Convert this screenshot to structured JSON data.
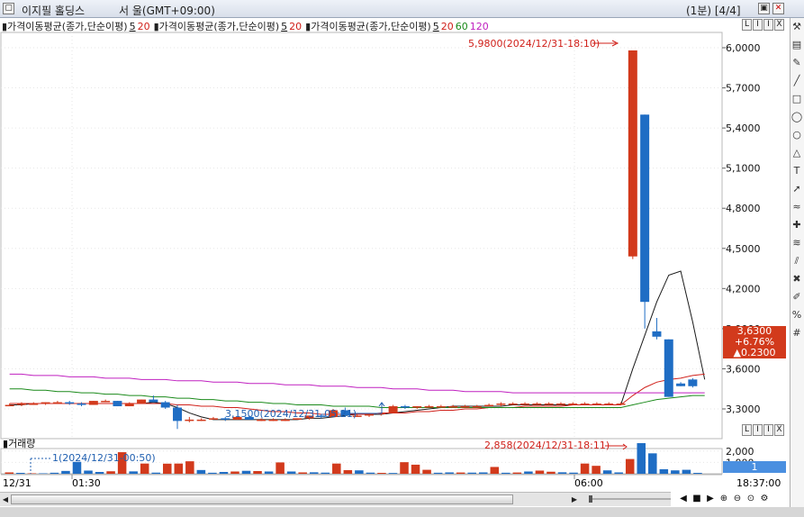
{
  "window": {
    "stock_name": "이지필 홀딩스",
    "market": "서  울(GMT+09:00)",
    "period": "(1분) [4/4]"
  },
  "legend": {
    "items": [
      {
        "label": "가격이동평균(종가,단순이평)",
        "periods": [
          {
            "text": "5",
            "color": "#1a1a1a"
          },
          {
            "text": "20",
            "color": "#d0201a"
          }
        ]
      },
      {
        "label": "가격이동평균(종가,단순이평)",
        "periods": [
          {
            "text": "5",
            "color": "#1a1a1a"
          },
          {
            "text": "20",
            "color": "#d0201a"
          }
        ]
      },
      {
        "label": "가격이동평균(종가,단순이평)",
        "periods": [
          {
            "text": "5",
            "color": "#1a1a1a"
          },
          {
            "text": "20",
            "color": "#d0201a"
          },
          {
            "text": "60",
            "color": "#1a8a1a"
          },
          {
            "text": "120",
            "color": "#c020c0"
          }
        ]
      }
    ]
  },
  "panel_buttons": [
    "L",
    "I",
    "I",
    "X"
  ],
  "current_price": {
    "price": "3,6300",
    "change_pct": "+6.76%",
    "change": "▲0.2300"
  },
  "volume_panel": {
    "title": "거래량",
    "current": "1",
    "min_annotation": "1(2024/12/31-00:50)",
    "max_annotation": "2,858(2024/12/31-18:11)"
  },
  "price_annotations": {
    "high": "5,9800(2024/12/31-18:10)",
    "low": "3,1500(2024/12/31-05:21)"
  },
  "time_labels": {
    "left": "12/31",
    "t1": "01:30",
    "t2": "06:00",
    "right": "18:37:00"
  },
  "toolbar_icons": [
    "tool-icon",
    "chart-icon",
    "draw-icon",
    "line-icon",
    "rect-icon",
    "ellipse-icon",
    "circle-icon",
    "triangle-icon",
    "text-icon",
    "arrow-icon",
    "wave-icon",
    "cross-icon",
    "fib-icon",
    "channel-icon",
    "delete-icon",
    "edit-icon",
    "percent-icon",
    "counter-icon"
  ],
  "colors": {
    "up": "#d23a1c",
    "down": "#1f6dc4",
    "ma5": "#1a1a1a",
    "ma20": "#d0201a",
    "ma60": "#1a8a1a",
    "ma120": "#c020c0"
  },
  "chart_data": [
    {
      "type": "candlestick",
      "title": "",
      "ylim": [
        3.2,
        6.1
      ],
      "yticks": [
        "6,0000",
        "5,7000",
        "5,4000",
        "5,1000",
        "4,8000",
        "4,5000",
        "4,2000",
        "3,9000",
        "3,6000",
        "3,3000"
      ],
      "ytick_values": [
        6.0,
        5.7,
        5.4,
        5.1,
        4.8,
        4.5,
        4.2,
        3.9,
        3.6,
        3.3
      ],
      "candles": [
        {
          "o": 3.33,
          "h": 3.34,
          "l": 3.32,
          "c": 3.33
        },
        {
          "o": 3.33,
          "h": 3.35,
          "l": 3.32,
          "c": 3.34
        },
        {
          "o": 3.34,
          "h": 3.35,
          "l": 3.33,
          "c": 3.34
        },
        {
          "o": 3.34,
          "h": 3.35,
          "l": 3.33,
          "c": 3.35
        },
        {
          "o": 3.35,
          "h": 3.36,
          "l": 3.34,
          "c": 3.35
        },
        {
          "o": 3.35,
          "h": 3.36,
          "l": 3.33,
          "c": 3.34
        },
        {
          "o": 3.34,
          "h": 3.35,
          "l": 3.32,
          "c": 3.33
        },
        {
          "o": 3.33,
          "h": 3.36,
          "l": 3.33,
          "c": 3.36
        },
        {
          "o": 3.36,
          "h": 3.37,
          "l": 3.35,
          "c": 3.36
        },
        {
          "o": 3.36,
          "h": 3.36,
          "l": 3.32,
          "c": 3.32
        },
        {
          "o": 3.32,
          "h": 3.35,
          "l": 3.32,
          "c": 3.34
        },
        {
          "o": 3.34,
          "h": 3.37,
          "l": 3.34,
          "c": 3.37
        },
        {
          "o": 3.37,
          "h": 3.4,
          "l": 3.35,
          "c": 3.35
        },
        {
          "o": 3.35,
          "h": 3.36,
          "l": 3.3,
          "c": 3.31
        },
        {
          "o": 3.31,
          "h": 3.33,
          "l": 3.15,
          "c": 3.21
        },
        {
          "o": 3.21,
          "h": 3.24,
          "l": 3.2,
          "c": 3.22
        },
        {
          "o": 3.22,
          "h": 3.23,
          "l": 3.21,
          "c": 3.22
        },
        {
          "o": 3.22,
          "h": 3.24,
          "l": 3.22,
          "c": 3.23
        },
        {
          "o": 3.23,
          "h": 3.24,
          "l": 3.21,
          "c": 3.22
        },
        {
          "o": 3.22,
          "h": 3.24,
          "l": 3.22,
          "c": 3.24
        },
        {
          "o": 3.24,
          "h": 3.25,
          "l": 3.22,
          "c": 3.22
        },
        {
          "o": 3.22,
          "h": 3.23,
          "l": 3.21,
          "c": 3.22
        },
        {
          "o": 3.22,
          "h": 3.23,
          "l": 3.21,
          "c": 3.22
        },
        {
          "o": 3.22,
          "h": 3.23,
          "l": 3.21,
          "c": 3.22
        },
        {
          "o": 3.22,
          "h": 3.23,
          "l": 3.22,
          "c": 3.23
        },
        {
          "o": 3.23,
          "h": 3.25,
          "l": 3.22,
          "c": 3.25
        },
        {
          "o": 3.25,
          "h": 3.26,
          "l": 3.23,
          "c": 3.24
        },
        {
          "o": 3.24,
          "h": 3.3,
          "l": 3.24,
          "c": 3.29
        },
        {
          "o": 3.29,
          "h": 3.31,
          "l": 3.24,
          "c": 3.25
        },
        {
          "o": 3.25,
          "h": 3.27,
          "l": 3.24,
          "c": 3.25
        },
        {
          "o": 3.25,
          "h": 3.26,
          "l": 3.24,
          "c": 3.26
        },
        {
          "o": 3.26,
          "h": 3.27,
          "l": 3.25,
          "c": 3.27
        },
        {
          "o": 3.27,
          "h": 3.33,
          "l": 3.27,
          "c": 3.32
        },
        {
          "o": 3.32,
          "h": 3.33,
          "l": 3.3,
          "c": 3.31
        },
        {
          "o": 3.31,
          "h": 3.32,
          "l": 3.3,
          "c": 3.32
        },
        {
          "o": 3.32,
          "h": 3.33,
          "l": 3.31,
          "c": 3.32
        },
        {
          "o": 3.32,
          "h": 3.33,
          "l": 3.31,
          "c": 3.32
        },
        {
          "o": 3.32,
          "h": 3.33,
          "l": 3.31,
          "c": 3.32
        },
        {
          "o": 3.32,
          "h": 3.33,
          "l": 3.31,
          "c": 3.32
        },
        {
          "o": 3.32,
          "h": 3.33,
          "l": 3.31,
          "c": 3.32
        },
        {
          "o": 3.32,
          "h": 3.34,
          "l": 3.32,
          "c": 3.33
        },
        {
          "o": 3.33,
          "h": 3.35,
          "l": 3.32,
          "c": 3.34
        },
        {
          "o": 3.34,
          "h": 3.35,
          "l": 3.33,
          "c": 3.34
        },
        {
          "o": 3.34,
          "h": 3.35,
          "l": 3.33,
          "c": 3.34
        },
        {
          "o": 3.34,
          "h": 3.35,
          "l": 3.33,
          "c": 3.34
        },
        {
          "o": 3.34,
          "h": 3.35,
          "l": 3.33,
          "c": 3.34
        },
        {
          "o": 3.34,
          "h": 3.35,
          "l": 3.33,
          "c": 3.34
        },
        {
          "o": 3.34,
          "h": 3.35,
          "l": 3.33,
          "c": 3.34
        },
        {
          "o": 3.34,
          "h": 3.35,
          "l": 3.33,
          "c": 3.34
        },
        {
          "o": 3.34,
          "h": 3.35,
          "l": 3.33,
          "c": 3.34
        },
        {
          "o": 3.34,
          "h": 3.35,
          "l": 3.33,
          "c": 3.34
        },
        {
          "o": 3.34,
          "h": 3.35,
          "l": 3.33,
          "c": 3.34
        },
        {
          "o": 4.44,
          "h": 5.98,
          "l": 4.42,
          "c": 5.98
        },
        {
          "o": 5.5,
          "h": 5.5,
          "l": 3.9,
          "c": 4.1
        },
        {
          "o": 3.88,
          "h": 3.98,
          "l": 3.82,
          "c": 3.84
        },
        {
          "o": 3.82,
          "h": 3.82,
          "l": 3.39,
          "c": 3.39
        },
        {
          "o": 3.49,
          "h": 3.5,
          "l": 3.47,
          "c": 3.47
        },
        {
          "o": 3.52,
          "h": 3.53,
          "l": 3.46,
          "c": 3.47
        }
      ],
      "moving_averages": [
        {
          "name": "5",
          "color": "#1a1a1a",
          "values": [
            3.33,
            3.33,
            3.34,
            3.34,
            3.34,
            3.34,
            3.34,
            3.34,
            3.34,
            3.34,
            3.34,
            3.34,
            3.35,
            3.34,
            3.31,
            3.27,
            3.24,
            3.22,
            3.22,
            3.22,
            3.22,
            3.22,
            3.22,
            3.22,
            3.22,
            3.23,
            3.23,
            3.24,
            3.25,
            3.26,
            3.26,
            3.26,
            3.27,
            3.28,
            3.29,
            3.3,
            3.31,
            3.32,
            3.32,
            3.32,
            3.32,
            3.32,
            3.33,
            3.33,
            3.33,
            3.33,
            3.33,
            3.33,
            3.33,
            3.33,
            3.33,
            3.33,
            3.6,
            3.85,
            4.1,
            4.3,
            4.33,
            3.95,
            3.52
          ]
        },
        {
          "name": "20",
          "color": "#d0201a",
          "values": [
            3.34,
            3.34,
            3.34,
            3.34,
            3.34,
            3.34,
            3.34,
            3.34,
            3.34,
            3.34,
            3.34,
            3.34,
            3.34,
            3.34,
            3.33,
            3.33,
            3.32,
            3.32,
            3.31,
            3.31,
            3.3,
            3.29,
            3.28,
            3.28,
            3.27,
            3.27,
            3.26,
            3.26,
            3.26,
            3.26,
            3.26,
            3.27,
            3.27,
            3.27,
            3.28,
            3.28,
            3.29,
            3.29,
            3.3,
            3.3,
            3.31,
            3.31,
            3.31,
            3.32,
            3.32,
            3.32,
            3.32,
            3.33,
            3.33,
            3.33,
            3.33,
            3.33,
            3.4,
            3.46,
            3.5,
            3.52,
            3.53,
            3.55,
            3.56
          ]
        },
        {
          "name": "60",
          "color": "#1a8a1a",
          "values": [
            3.45,
            3.45,
            3.44,
            3.44,
            3.43,
            3.43,
            3.42,
            3.42,
            3.41,
            3.41,
            3.4,
            3.4,
            3.39,
            3.39,
            3.38,
            3.38,
            3.37,
            3.37,
            3.36,
            3.36,
            3.35,
            3.35,
            3.34,
            3.34,
            3.33,
            3.33,
            3.33,
            3.32,
            3.32,
            3.32,
            3.32,
            3.31,
            3.31,
            3.31,
            3.31,
            3.31,
            3.31,
            3.31,
            3.31,
            3.31,
            3.31,
            3.31,
            3.31,
            3.31,
            3.31,
            3.31,
            3.31,
            3.31,
            3.31,
            3.31,
            3.31,
            3.31,
            3.33,
            3.35,
            3.37,
            3.38,
            3.39,
            3.4,
            3.4
          ]
        },
        {
          "name": "120",
          "color": "#c020c0",
          "values": [
            3.56,
            3.56,
            3.55,
            3.55,
            3.55,
            3.54,
            3.54,
            3.54,
            3.53,
            3.53,
            3.53,
            3.52,
            3.52,
            3.52,
            3.51,
            3.51,
            3.51,
            3.5,
            3.5,
            3.5,
            3.49,
            3.49,
            3.49,
            3.48,
            3.48,
            3.48,
            3.47,
            3.47,
            3.47,
            3.46,
            3.46,
            3.46,
            3.45,
            3.45,
            3.45,
            3.44,
            3.44,
            3.44,
            3.43,
            3.43,
            3.43,
            3.43,
            3.42,
            3.42,
            3.42,
            3.42,
            3.42,
            3.42,
            3.42,
            3.42,
            3.42,
            3.42,
            3.42,
            3.42,
            3.42,
            3.42,
            3.42,
            3.42,
            3.42
          ]
        }
      ]
    },
    {
      "type": "bar",
      "title": "거래량",
      "ylim": [
        0,
        3000
      ],
      "yticks": [
        "2,000",
        "1,000"
      ],
      "ytick_values": [
        2000,
        1000
      ],
      "values": [
        120,
        80,
        40,
        40,
        90,
        250,
        1050,
        280,
        160,
        220,
        1900,
        210,
        900,
        100,
        890,
        900,
        1100,
        330,
        90,
        160,
        200,
        260,
        240,
        200,
        1000,
        200,
        120,
        130,
        100,
        900,
        320,
        300,
        100,
        80,
        70,
        1020,
        800,
        350,
        90,
        120,
        110,
        100,
        120,
        600,
        90,
        110,
        200,
        280,
        180,
        130,
        100,
        900,
        700,
        300,
        120,
        1300,
        2858,
        1800,
        400,
        300,
        350,
        80
      ],
      "directions": [
        "up",
        "down",
        "up",
        "down",
        "down",
        "down",
        "down",
        "down",
        "down",
        "up",
        "up",
        "down",
        "up",
        "down",
        "up",
        "up",
        "up",
        "down",
        "down",
        "down",
        "up",
        "down",
        "up",
        "down",
        "up",
        "down",
        "up",
        "down",
        "down",
        "up",
        "up",
        "down",
        "down",
        "up",
        "down",
        "up",
        "up",
        "up",
        "down",
        "down",
        "up",
        "down",
        "down",
        "up",
        "down",
        "up",
        "down",
        "up",
        "up",
        "down",
        "down",
        "up",
        "up",
        "down",
        "down",
        "up",
        "down",
        "down",
        "down",
        "down",
        "down",
        "down"
      ]
    }
  ]
}
